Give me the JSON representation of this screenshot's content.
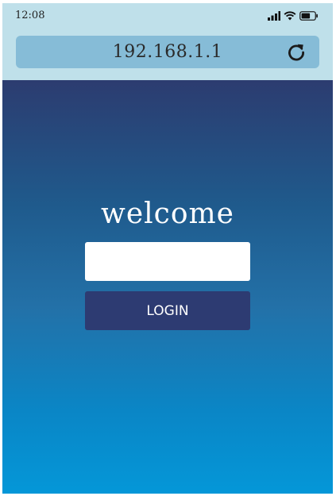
{
  "status_bar": {
    "time": "12:08",
    "icons": [
      "signal-icon",
      "wifi-icon",
      "battery-icon"
    ]
  },
  "browser": {
    "url": "192.168.1.1",
    "reload_icon": "reload-icon"
  },
  "login": {
    "heading": "welcome",
    "input_value": "",
    "input_placeholder": "",
    "button_label": "LOGIN"
  },
  "colors": {
    "status_bar_bg": "#bfe0ea",
    "url_bar_bg": "#86bcd7",
    "gradient_top": "#2c3c70",
    "gradient_bottom": "#0497d8",
    "button_bg": "#2d3b72",
    "text_light": "#ffffff"
  }
}
